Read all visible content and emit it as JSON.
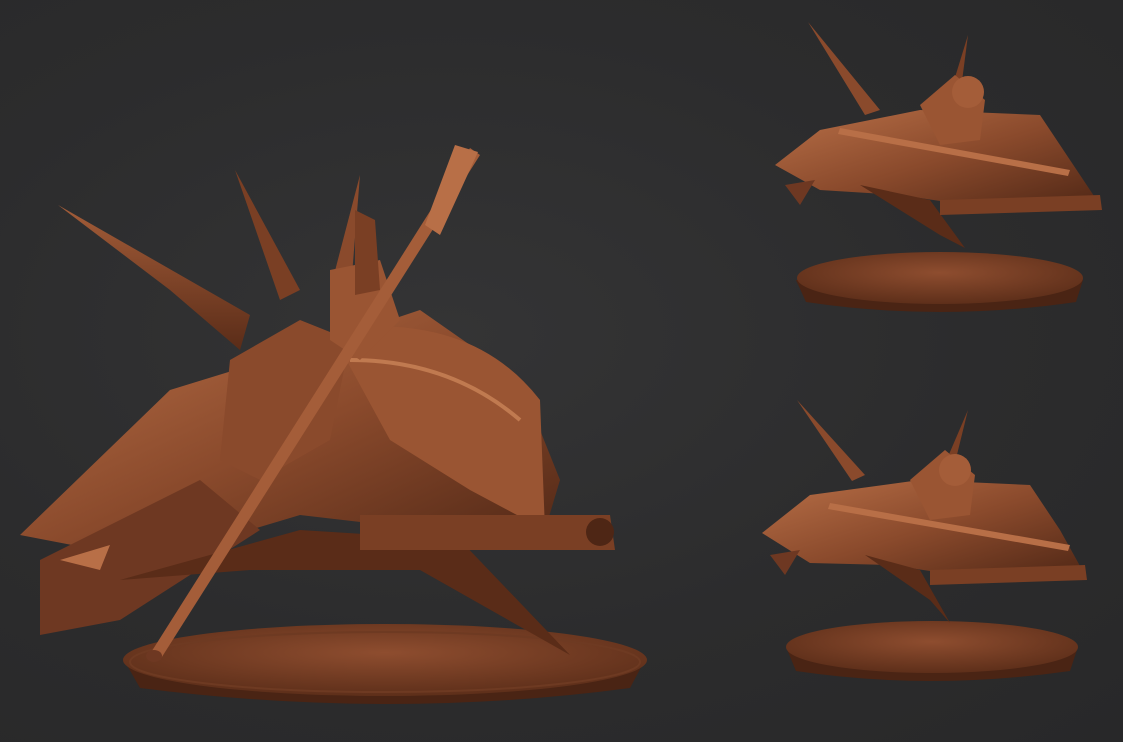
{
  "scene": {
    "subject": "miniature-jetbike-render",
    "views": [
      "main-view",
      "top-right-view",
      "bottom-right-view"
    ]
  },
  "colors": {
    "background": "#2d2d2e",
    "clay_base": "#8a4a2c",
    "clay_light": "#b86f47",
    "clay_dark": "#4e2615",
    "clay_shadow": "#3a1c10"
  }
}
